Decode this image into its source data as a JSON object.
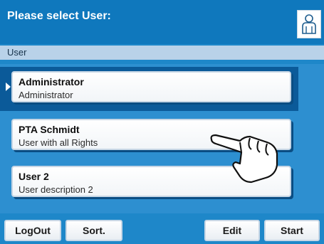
{
  "header": {
    "title": "Please select User:"
  },
  "section": {
    "label": "User"
  },
  "users": [
    {
      "name": "Administrator",
      "description": "Administrator"
    },
    {
      "name": "PTA Schmidt",
      "description": "User with all Rights"
    },
    {
      "name": "User 2",
      "description": "User description  2"
    }
  ],
  "footer": {
    "logout_label": "LogOut",
    "sort_label": "Sort.",
    "edit_label": "Edit",
    "start_label": "Start"
  },
  "icons": {
    "user": "user-icon",
    "selection": "selection-marker-icon",
    "pointer": "hand-pointer-icon"
  },
  "colors": {
    "background": "#1e87c9",
    "header": "#0f78bd",
    "selected_row": "#0b5a99",
    "section_bar": "#b9d2e9"
  }
}
